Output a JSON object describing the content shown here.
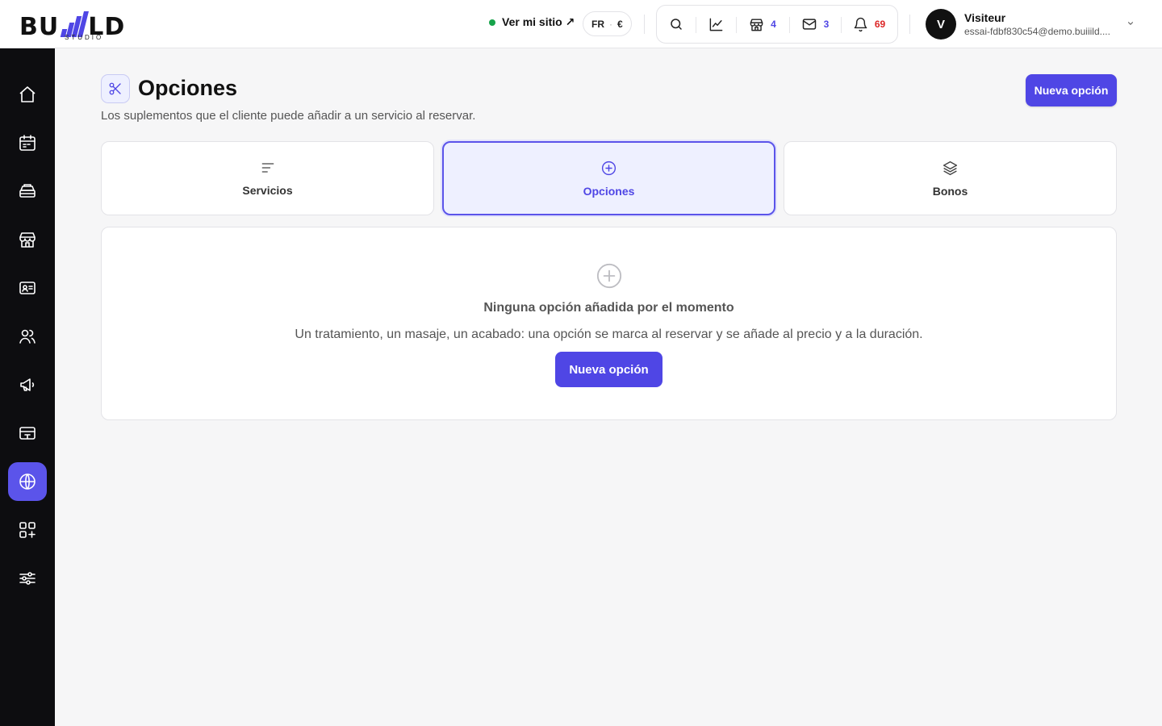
{
  "brand": {
    "logo_left": "BU",
    "logo_right": "LD",
    "logo_sub": "STUDIO",
    "accent": "#4f46e5"
  },
  "header": {
    "site_link": "Ver mi sitio ↗",
    "lang": "FR",
    "currency": "€",
    "tools": [
      {
        "icon": "search-icon"
      },
      {
        "icon": "chart-line-icon"
      },
      {
        "icon": "store-icon",
        "count": "4"
      },
      {
        "icon": "mail-icon",
        "count": "3"
      },
      {
        "icon": "bell-icon",
        "count": "69"
      }
    ],
    "user": {
      "initial": "V",
      "name": "Visiteur",
      "email": "essai-fdbf830c54@demo.buiiild...."
    }
  },
  "sidebar": {
    "items": [
      {
        "icon": "home-icon"
      },
      {
        "icon": "calendar-icon"
      },
      {
        "icon": "register-icon"
      },
      {
        "icon": "store-icon"
      },
      {
        "icon": "id-card-icon"
      },
      {
        "icon": "users-icon"
      },
      {
        "icon": "megaphone-icon"
      },
      {
        "icon": "payment-terminal-icon"
      },
      {
        "icon": "globe-icon",
        "active": true
      },
      {
        "icon": "apps-add-icon"
      },
      {
        "icon": "sliders-icon"
      }
    ]
  },
  "page": {
    "title": "Opciones",
    "subtitle": "Los suplementos que el cliente puede añadir a un servicio al reservar.",
    "new_button": "Nueva opción"
  },
  "tabs": [
    {
      "label": "Servicios",
      "icon": "list-icon"
    },
    {
      "label": "Opciones",
      "icon": "plus-circle-icon",
      "active": true
    },
    {
      "label": "Bonos",
      "icon": "layers-icon"
    }
  ],
  "empty_state": {
    "icon": "plus-circle-icon",
    "title": "Ninguna opción añadida por el momento",
    "text": "Un tratamiento, un masaje, un acabado: una opción se marca al reservar y se añade al precio y a la duración.",
    "button": "Nueva opción"
  }
}
